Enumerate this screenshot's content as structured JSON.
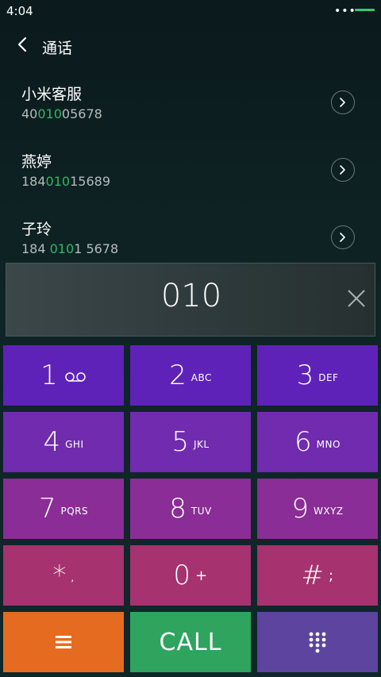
{
  "status_bar": {
    "time": "4:04",
    "dots": "•••"
  },
  "header": {
    "title": "通话"
  },
  "contacts": [
    {
      "name": "小米客服",
      "num_pre": "40",
      "num_hl": "010",
      "num_post": "05678"
    },
    {
      "name": "燕婷",
      "num_pre": "184",
      "num_hl": "010",
      "num_post": "15689"
    },
    {
      "name": "子玲",
      "num_pre": "184 ",
      "num_hl": "010",
      "num_post": "1 5678"
    }
  ],
  "display": {
    "digits": "010"
  },
  "keypad": {
    "k1": {
      "digit": "1",
      "sub": ""
    },
    "k2": {
      "digit": "2",
      "sub": "ABC"
    },
    "k3": {
      "digit": "3",
      "sub": "DEF"
    },
    "k4": {
      "digit": "4",
      "sub": "GHI"
    },
    "k5": {
      "digit": "5",
      "sub": "JKL"
    },
    "k6": {
      "digit": "6",
      "sub": "MNO"
    },
    "k7": {
      "digit": "7",
      "sub": "PQRS"
    },
    "k8": {
      "digit": "8",
      "sub": "TUV"
    },
    "k9": {
      "digit": "9",
      "sub": "WXYZ"
    },
    "kstar": {
      "digit": "*",
      "sub": ","
    },
    "k0": {
      "digit": "0",
      "sub": "+"
    },
    "khash": {
      "digit": "#",
      "sub": ";"
    }
  },
  "actions": {
    "call_label": "CALL"
  },
  "icons": {
    "voicemail": "voicemail-icon",
    "menu": "menu-icon",
    "dialpad": "dialpad-icon"
  },
  "colors": {
    "highlight": "#2fb864",
    "call": "#2ea45f",
    "menu": "#e56b20",
    "dialpad_toggle": "#5d449e"
  }
}
